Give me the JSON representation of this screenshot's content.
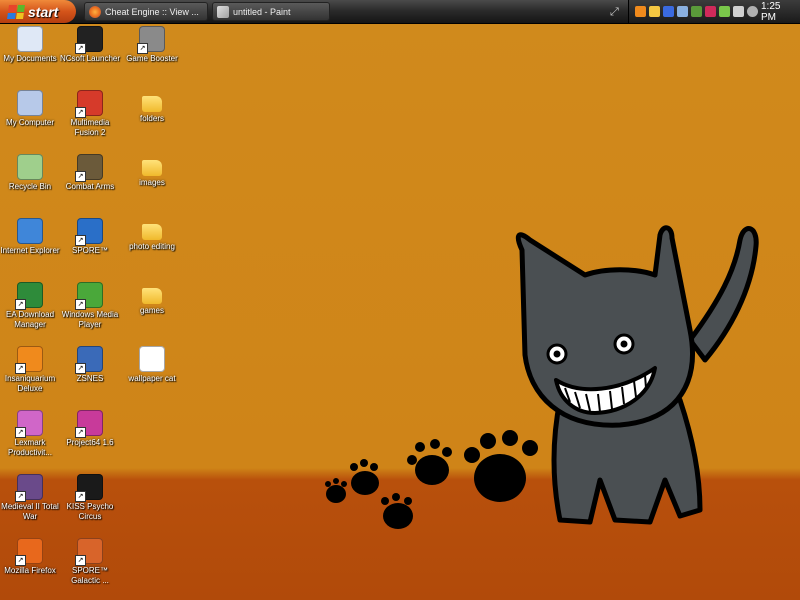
{
  "taskbar": {
    "start_label": "start",
    "windows": [
      {
        "label": "Cheat Engine :: View ...",
        "icon": "firefox-icon",
        "color": "#e86a1a"
      },
      {
        "label": "untitled - Paint",
        "icon": "paint-icon",
        "color": "#c8c8c8"
      }
    ],
    "clock": "1:25 PM"
  },
  "desktop": {
    "icons": [
      {
        "label": "My Documents",
        "name": "my-documents",
        "color": "#dfe8f6",
        "shortcut": false
      },
      {
        "label": "My Computer",
        "name": "my-computer",
        "color": "#b7c9e9",
        "shortcut": false
      },
      {
        "label": "Recycle Bin",
        "name": "recycle-bin",
        "color": "#9fcf8c",
        "shortcut": false
      },
      {
        "label": "Internet Explorer",
        "name": "internet-explorer",
        "color": "#3f86d9",
        "shortcut": false
      },
      {
        "label": "EA Download Manager",
        "name": "ea-download-manager",
        "color": "#2e8b3a",
        "shortcut": true
      },
      {
        "label": "Insaniquarium Deluxe",
        "name": "insaniquarium",
        "color": "#f08a1c",
        "shortcut": true
      },
      {
        "label": "Lexmark Productivit...",
        "name": "lexmark",
        "color": "#d066c8",
        "shortcut": true
      },
      {
        "label": "Medieval II Total War",
        "name": "medieval-2",
        "color": "#6a4a8a",
        "shortcut": true
      },
      {
        "label": "Mozilla Firefox",
        "name": "mozilla-firefox",
        "color": "#e8681c",
        "shortcut": true
      },
      {
        "label": "NCsoft Launcher",
        "name": "ncsoft-launcher",
        "color": "#222222",
        "shortcut": true
      },
      {
        "label": "Multimedia Fusion 2",
        "name": "multimedia-fusion-2",
        "color": "#d63a2a",
        "shortcut": true
      },
      {
        "label": "Combat Arms",
        "name": "combat-arms",
        "color": "#6b5a3a",
        "shortcut": true
      },
      {
        "label": "SPORE™",
        "name": "spore",
        "color": "#2a6fc8",
        "shortcut": true
      },
      {
        "label": "Windows Media Player",
        "name": "windows-media-player",
        "color": "#4aa83a",
        "shortcut": true
      },
      {
        "label": "ZSNES",
        "name": "zsnes",
        "color": "#3a6ab8",
        "shortcut": true
      },
      {
        "label": "Project64 1.6",
        "name": "project64",
        "color": "#c83a9a",
        "shortcut": true
      },
      {
        "label": "KISS Psycho Circus",
        "name": "kiss-psycho-circus",
        "color": "#1a1a1a",
        "shortcut": true
      },
      {
        "label": "SPORE™ Galactic ...",
        "name": "spore-galactic",
        "color": "#d8642a",
        "shortcut": true
      },
      {
        "label": "Game Booster",
        "name": "game-booster",
        "color": "#8a8a8a",
        "shortcut": true
      },
      {
        "label": "folders",
        "name": "folders",
        "color": "#f5c842",
        "shortcut": false,
        "folder": true
      },
      {
        "label": "images",
        "name": "images",
        "color": "#f5c842",
        "shortcut": false,
        "folder": true
      },
      {
        "label": "photo editing",
        "name": "photo-editing",
        "color": "#f5c842",
        "shortcut": false,
        "folder": true
      },
      {
        "label": "games",
        "name": "games",
        "color": "#f5c842",
        "shortcut": false,
        "folder": true
      },
      {
        "label": "wallpaper cat",
        "name": "wallpaper-cat",
        "color": "#ffffff",
        "shortcut": false
      }
    ]
  },
  "colors": {
    "background": "#d08a1c",
    "floor": "#b14a0a",
    "cat": "#4a4f52"
  }
}
